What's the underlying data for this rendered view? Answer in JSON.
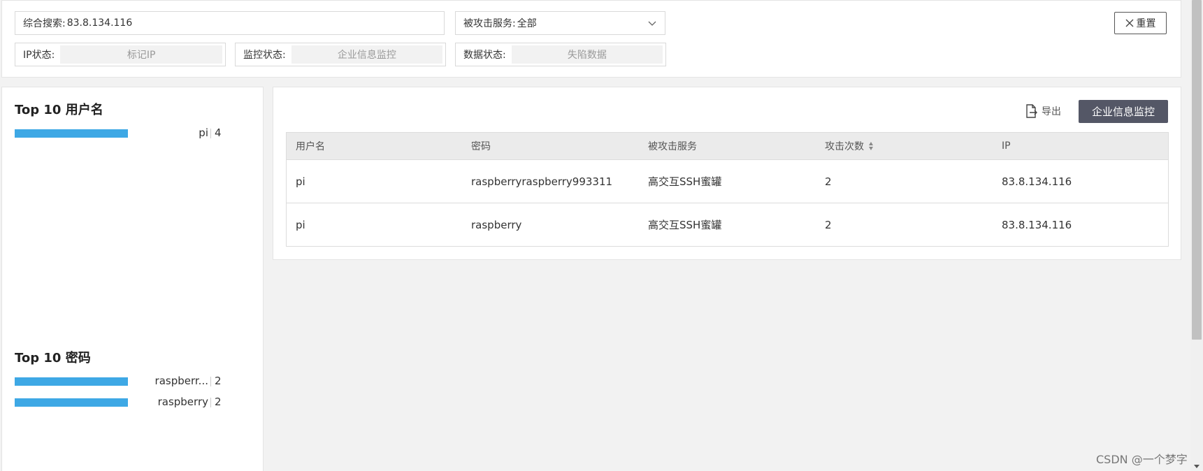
{
  "filters": {
    "search_label": "综合搜索:",
    "search_value": "83.8.134.116",
    "service_label": "被攻击服务:",
    "service_value": "全部",
    "ip_status_label": "IP状态:",
    "ip_status_value": "标记IP",
    "monitor_status_label": "监控状态:",
    "monitor_status_value": "企业信息监控",
    "data_status_label": "数据状态:",
    "data_status_value": "失陷数据",
    "reset_label": "重置"
  },
  "top_usernames": {
    "title": "Top 10 用户名",
    "items": [
      {
        "label": "pi",
        "count": "4",
        "fraction": 1.0
      }
    ]
  },
  "top_passwords": {
    "title": "Top 10 密码",
    "items": [
      {
        "label": "raspberr...",
        "count": "2",
        "fraction": 1.0
      },
      {
        "label": "raspberry",
        "count": "2",
        "fraction": 1.0
      }
    ]
  },
  "toolbar": {
    "export_label": "导出",
    "monitor_button_label": "企业信息监控"
  },
  "table": {
    "headers": [
      "用户名",
      "密码",
      "被攻击服务",
      "攻击次数",
      "IP"
    ],
    "rows": [
      [
        "pi",
        "raspberryraspberry993311",
        "高交互SSH蜜罐",
        "2",
        "83.8.134.116"
      ],
      [
        "pi",
        "raspberry",
        "高交互SSH蜜罐",
        "2",
        "83.8.134.116"
      ]
    ]
  },
  "watermark": "CSDN @一个梦字"
}
